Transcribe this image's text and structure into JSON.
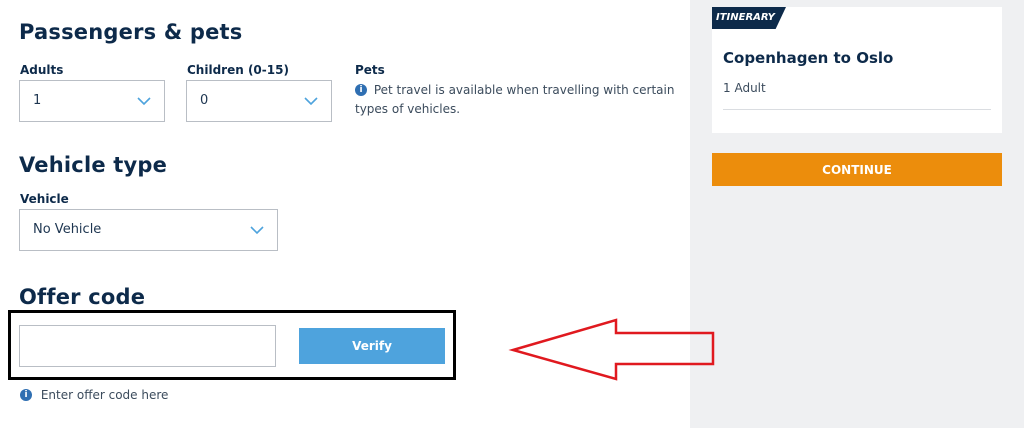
{
  "passengers": {
    "heading": "Passengers & pets",
    "adults_label": "Adults",
    "adults_value": "1",
    "children_label": "Children (0-15)",
    "children_value": "0",
    "pets_label": "Pets",
    "pets_info": "Pet travel is available when travelling with certain types of vehicles."
  },
  "vehicle": {
    "heading": "Vehicle type",
    "label": "Vehicle",
    "value": "No Vehicle"
  },
  "offer": {
    "heading": "Offer code",
    "input_value": "",
    "verify_label": "Verify",
    "hint": "Enter offer code here"
  },
  "itinerary": {
    "tag": "ITINERARY",
    "route": "Copenhagen to Oslo",
    "passengers": "1 Adult",
    "continue_label": "CONTINUE"
  },
  "icons": {
    "info": "info-icon",
    "dropdown": "chevron-down-icon",
    "annotation": "red-arrow-annotation"
  },
  "colors": {
    "navy": "#0d2a4a",
    "verify_blue": "#4ea3dd",
    "continue_orange": "#ec8d0c",
    "sidebar_bg": "#eff0f2",
    "annotation_red": "#e0191f",
    "highlight_border": "#000000"
  }
}
